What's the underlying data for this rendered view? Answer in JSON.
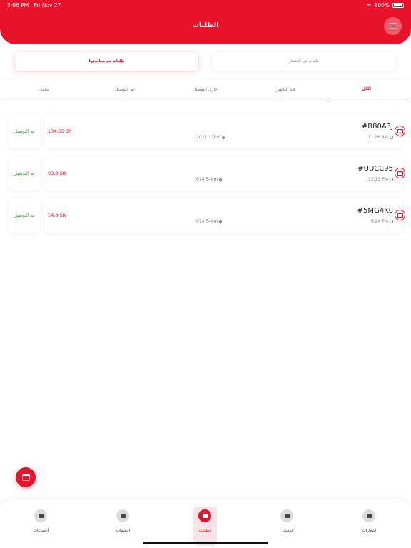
{
  "status_bar": {
    "time": "3:06 PM",
    "date": "Fri Nov 27",
    "battery": "100%",
    "wifi_icon": "wifi-icon"
  },
  "header": {
    "title": "الطلبات",
    "menu_icon": "hamburger-icon"
  },
  "segments": {
    "processed": "طلبات تم معالجتها",
    "pending": "طلبات في الإنتظار"
  },
  "tabs": [
    {
      "label": "الكل"
    },
    {
      "label": "قيد التجهيز"
    },
    {
      "label": "جارى التوصيل"
    },
    {
      "label": "تم التوصيل"
    },
    {
      "label": "ملغى"
    }
  ],
  "orders": [
    {
      "code": "#B80A3J",
      "time": "11:26 AM",
      "distance": "2021.12km",
      "price": "134.55 SR",
      "status": "تم التوصيل"
    },
    {
      "code": "#UUCC95",
      "time": "12:13 PM",
      "distance": "674.54km",
      "price": "93.0 SR",
      "status": "تم التوصيل"
    },
    {
      "code": "#5MG4K0",
      "time": "6:24 PM",
      "distance": "674.54km",
      "price": "54.0 SR",
      "status": "تم التوصيل"
    }
  ],
  "bottom_nav": [
    {
      "label": "أحصائيات",
      "icon": "stats-icon"
    },
    {
      "label": "التقيمات",
      "icon": "ratings-icon"
    },
    {
      "label": "الطلبات",
      "icon": "orders-icon"
    },
    {
      "label": "الرسائل",
      "icon": "messages-icon"
    },
    {
      "label": "اشعارات",
      "icon": "bell-icon"
    }
  ],
  "colors": {
    "accent": "#e8132a",
    "delivered": "#3aab3a"
  }
}
